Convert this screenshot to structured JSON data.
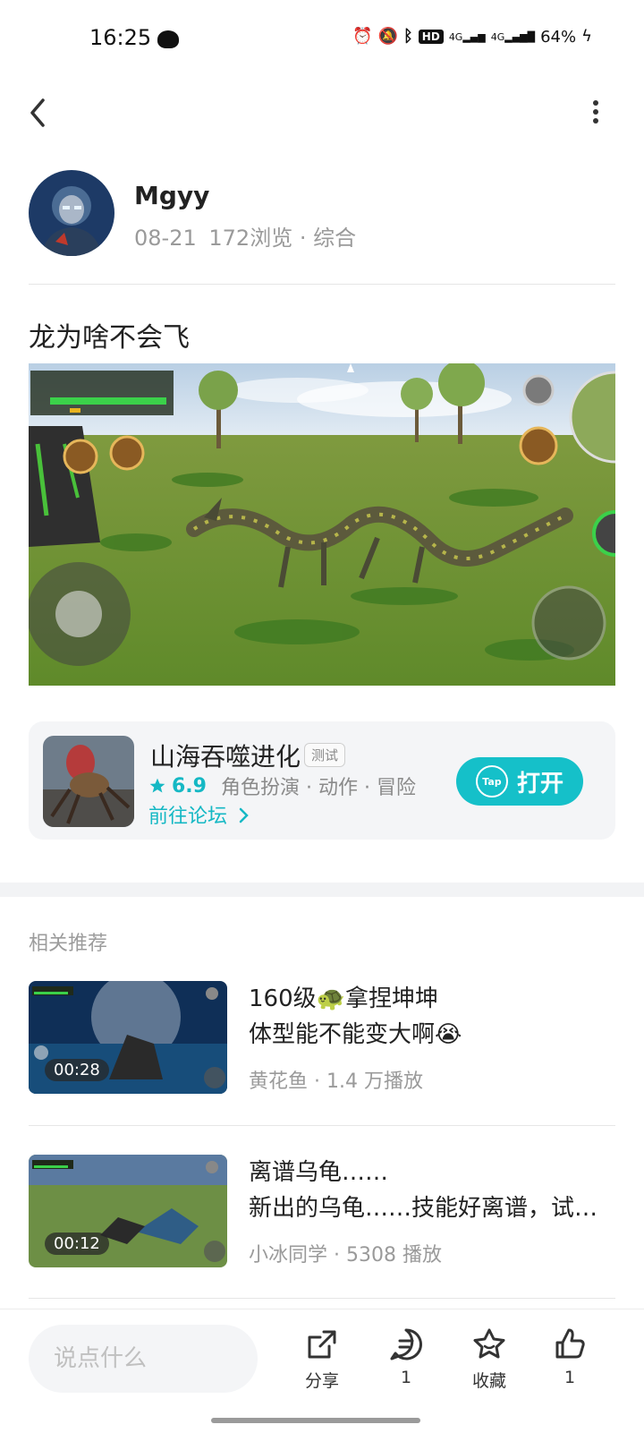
{
  "status_bar": {
    "time": "16:25",
    "battery": "64%",
    "hd": "HD",
    "net1": "4G",
    "net2": "4G"
  },
  "author": {
    "name": "Mgyy",
    "date": "08-21",
    "views": "172浏览",
    "category": "综合"
  },
  "post": {
    "title": "龙为啥不会飞"
  },
  "app_card": {
    "name": "山海吞噬进化",
    "tag": "测试",
    "score": "6.9",
    "genres": "角色扮演 · 动作 · 冒险",
    "forum_link": "前往论坛",
    "open_label": "打开",
    "tap_text": "Tap"
  },
  "related": {
    "title": "相关推荐",
    "items": [
      {
        "title_line1": "160级🐢拿捏坤坤",
        "title_line2": "体型能不能变大啊😭",
        "author": "黄花鱼",
        "plays": "1.4 万播放",
        "duration": "00:28"
      },
      {
        "title_line1": "离谱乌龟……",
        "title_line2": "新出的乌龟……技能好离谱，试…",
        "author": "小冰同学",
        "plays": "5308 播放",
        "duration": "00:12"
      }
    ]
  },
  "bottom_bar": {
    "comment_placeholder": "说点什么",
    "share_label": "分享",
    "comment_count": "1",
    "favorite_label": "收藏",
    "like_count": "1"
  },
  "colors": {
    "accent": "#15c0c9",
    "text": "#222222",
    "muted": "#9a9a9a"
  }
}
